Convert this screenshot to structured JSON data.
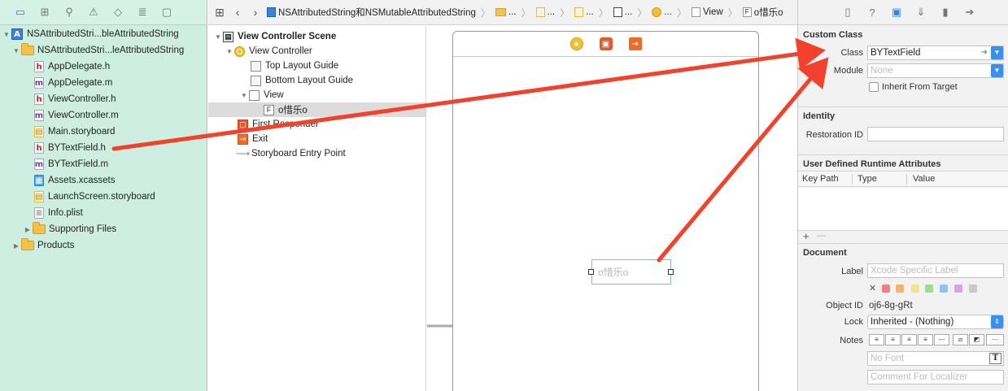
{
  "navigator": {
    "toolbar_icons": [
      "folder-icon",
      "grid-icon",
      "search-icon",
      "warning-icon",
      "diamond-icon",
      "bars-icon",
      "chat-icon"
    ],
    "items": [
      {
        "label": "NSAttributedStri...bleAttributedString",
        "type": "project",
        "level": 0
      },
      {
        "label": "NSAttributedStri...leAttributedString",
        "type": "folder",
        "level": 1
      },
      {
        "label": "AppDelegate.h",
        "type": "h",
        "level": 2
      },
      {
        "label": "AppDelegate.m",
        "type": "m",
        "level": 2
      },
      {
        "label": "ViewController.h",
        "type": "h",
        "level": 2
      },
      {
        "label": "ViewController.m",
        "type": "m",
        "level": 2
      },
      {
        "label": "Main.storyboard",
        "type": "storyboard",
        "level": 2
      },
      {
        "label": "BYTextField.h",
        "type": "h",
        "level": 2
      },
      {
        "label": "BYTextField.m",
        "type": "m",
        "level": 2
      },
      {
        "label": "Assets.xcassets",
        "type": "assets",
        "level": 2
      },
      {
        "label": "LaunchScreen.storyboard",
        "type": "storyboard",
        "level": 2
      },
      {
        "label": "Info.plist",
        "type": "plist",
        "level": 2
      },
      {
        "label": "Supporting Files",
        "type": "folder",
        "level": 2
      },
      {
        "label": "Products",
        "type": "folder",
        "level": 1
      }
    ]
  },
  "jumpbar": {
    "project": "NSAttributedString和NSMutableAttributedString",
    "crumb_ellipsis": "...",
    "view": "View",
    "field_icon": "F",
    "field": "o惜乐o"
  },
  "outline": {
    "scene": "View Controller Scene",
    "view_controller": "View Controller",
    "top_guide": "Top Layout Guide",
    "bottom_guide": "Bottom Layout Guide",
    "view": "View",
    "field_icon": "F",
    "field": "o惜乐o",
    "first_responder": "First Responder",
    "exit": "Exit",
    "entry_point": "Storyboard Entry Point"
  },
  "canvas": {
    "textfield_text": "o惜乐o"
  },
  "inspector": {
    "custom_class": {
      "title": "Custom Class",
      "class_label": "Class",
      "class_value": "BYTextField",
      "module_label": "Module",
      "module_placeholder": "None",
      "inherit_label": "Inherit From Target"
    },
    "identity": {
      "title": "Identity",
      "restoration_label": "Restoration ID",
      "restoration_value": ""
    },
    "runtime_attributes": {
      "title": "User Defined Runtime Attributes",
      "columns": [
        "Key Path",
        "Type",
        "Value"
      ],
      "add": "+",
      "remove": "—"
    },
    "document": {
      "title": "Document",
      "label_label": "Label",
      "label_placeholder": "Xcode Specific Label",
      "swatches": [
        "#f08080",
        "#f5b26b",
        "#f1e38a",
        "#9fdc8e",
        "#8cc4f2",
        "#d5a6e6",
        "#c8c8c8"
      ],
      "object_id_label": "Object ID",
      "object_id": "oj6-8g-gRt",
      "lock_label": "Lock",
      "lock_value": "Inherited - (Nothing)",
      "notes_label": "Notes",
      "font_placeholder": "No Font",
      "comment_placeholder": "Comment For Localizer"
    }
  },
  "colors": {
    "navigator_bg": "#cdeee0",
    "accent": "#3b8ff0",
    "annotation_arrow": "#f2422c"
  }
}
